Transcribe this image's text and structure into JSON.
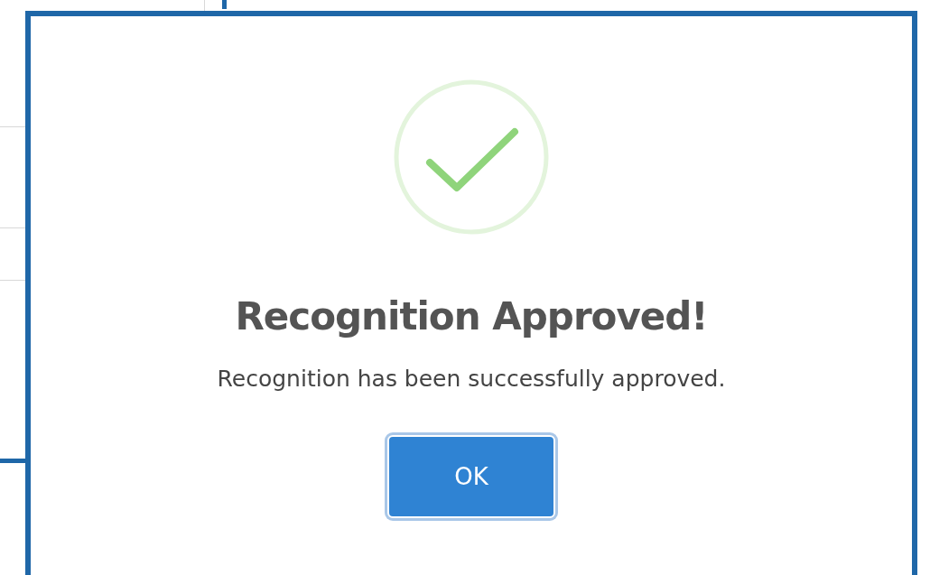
{
  "dialog": {
    "title": "Recognition Approved!",
    "message": "Recognition has been successfully approved.",
    "button": "OK"
  }
}
